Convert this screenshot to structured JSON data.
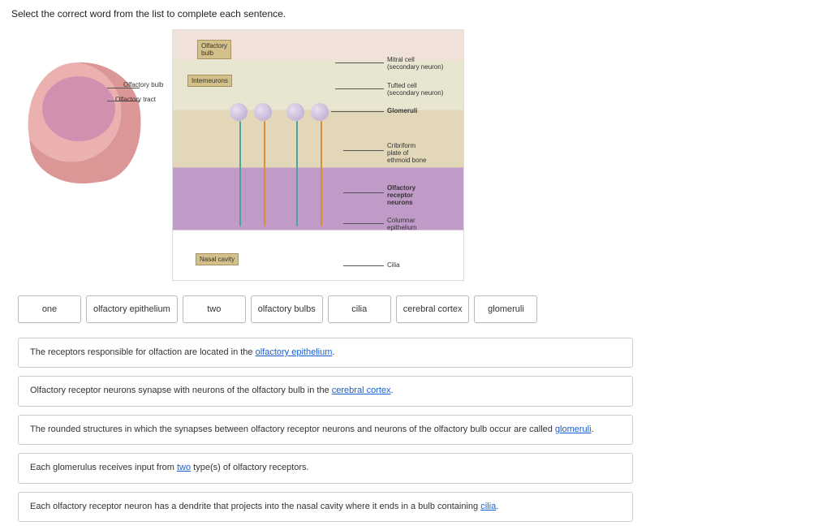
{
  "instruction": "Select the correct word from the list to complete each sentence.",
  "figure": {
    "left": {
      "labels": {
        "olfactory_bulb": "Olfactory bulb",
        "olfactory_tract": "Olfactory tract"
      }
    },
    "right": {
      "chips": {
        "olfactory_bulb": "Olfactory\nbulb",
        "interneurons": "Interneurons",
        "nasal_cavity": "Nasal cavity"
      },
      "labels": {
        "mitral": "Mitral cell\n(secondary neuron)",
        "tufted": "Tufted cell\n(secondary neuron)",
        "glomeruli": "Glomeruli",
        "cribriform": "Cribriform\nplate of\nethmoid bone",
        "receptor": "Olfactory\nreceptor\nneurons",
        "columnar": "Columnar\nepithelium",
        "cilia": "Cilia"
      }
    }
  },
  "word_bank": [
    "one",
    "olfactory epithelium",
    "two",
    "olfactory bulbs",
    "cilia",
    "cerebral cortex",
    "glomeruli"
  ],
  "sentences": [
    {
      "pre": "The receptors responsible for olfaction are located in the ",
      "answer": "olfactory epithelium",
      "post": "."
    },
    {
      "pre": "Olfactory receptor neurons synapse with neurons of the olfactory bulb in the ",
      "answer": "cerebral cortex",
      "post": "."
    },
    {
      "pre": "The rounded structures in which the synapses between olfactory receptor neurons and neurons of the olfactory bulb occur are called ",
      "answer": "glomeruli",
      "post": "."
    },
    {
      "pre": "Each glomerulus receives input from ",
      "answer": "two",
      "post": " type(s) of olfactory receptors."
    },
    {
      "pre": "Each olfactory receptor neuron has a dendrite that projects into the nasal cavity where it ends in a bulb containing ",
      "answer": "cilia",
      "post": "."
    }
  ]
}
